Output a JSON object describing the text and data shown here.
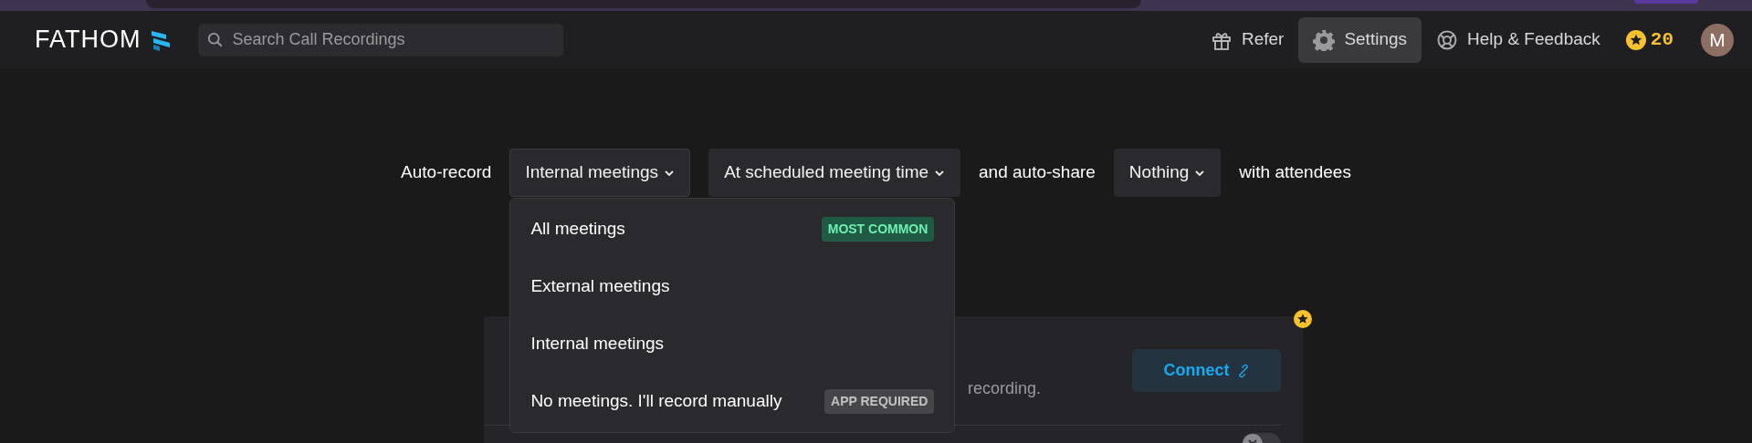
{
  "nav": {
    "logo": "FATHOM",
    "search": {
      "placeholder": "Search Call Recordings"
    },
    "links": [
      {
        "label": "Refer",
        "kind": "gift",
        "selected": false
      },
      {
        "label": "Settings",
        "kind": "gear",
        "selected": true
      },
      {
        "label": "Help & Feedback",
        "kind": "lifebuoy",
        "selected": false
      }
    ],
    "points": "20",
    "avatar": "M"
  },
  "rule": [
    {
      "kind": "text",
      "text": "Auto-record"
    },
    {
      "kind": "select",
      "text": "Internal meetings",
      "expanded": true
    },
    {
      "kind": "select",
      "text": "At scheduled meeting time",
      "expanded": false
    },
    {
      "kind": "text",
      "text": "and auto-share"
    },
    {
      "kind": "select",
      "text": "Nothing",
      "expanded": false
    },
    {
      "kind": "text",
      "text": "with attendees"
    }
  ],
  "menu": {
    "items": [
      {
        "label": "All meetings",
        "badge": {
          "text": "MOST COMMON",
          "kind": "success"
        }
      },
      {
        "label": "External meetings"
      },
      {
        "label": "Internal meetings"
      },
      {
        "label": "No meetings. I'll record manually",
        "badge": {
          "text": "APP REQUIRED",
          "kind": "muted"
        }
      }
    ]
  },
  "card": {
    "description": "recording.",
    "button": "Connect",
    "toggle": {
      "on": false
    }
  }
}
